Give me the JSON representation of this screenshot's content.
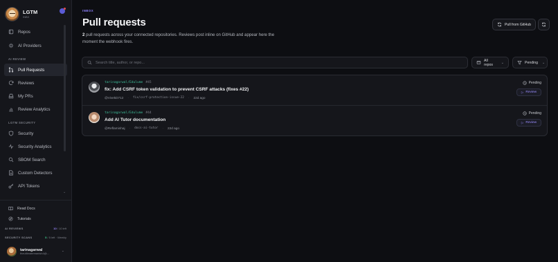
{
  "brand": {
    "name": "LGTM",
    "sub": "INBX"
  },
  "nav": {
    "top": [
      {
        "label": "Repos",
        "icon": "repo-icon",
        "active": false
      },
      {
        "label": "AI Providers",
        "icon": "sparkle-icon",
        "active": false
      }
    ],
    "ai_review_label": "AI REVIEW",
    "ai_review": [
      {
        "label": "Pull Requests",
        "icon": "pull-request-icon",
        "active": true
      },
      {
        "label": "Reviews",
        "icon": "refresh-icon",
        "active": false
      },
      {
        "label": "My PRs",
        "icon": "inbox-icon",
        "active": false
      },
      {
        "label": "Review Analytics",
        "icon": "chart-icon",
        "active": false
      }
    ],
    "security_label": "LGTM SECURITY",
    "security": [
      {
        "label": "Security",
        "icon": "shield-icon",
        "active": false
      },
      {
        "label": "Security Analytics",
        "icon": "activity-icon",
        "active": false
      },
      {
        "label": "SBOM Search",
        "icon": "search-icon",
        "active": false
      },
      {
        "label": "Custom Detectors",
        "icon": "file-icon",
        "active": false
      },
      {
        "label": "API Tokens",
        "icon": "key-icon",
        "active": false
      }
    ]
  },
  "bottom": {
    "read_docs": "Read Docs",
    "tutorials": "Tutorials",
    "ai_reviews_label": "AI REVIEWS",
    "ai_reviews_used": "10",
    "ai_reviews_rest": "/ 10 left",
    "security_scans_label": "SECURITY SCANS",
    "security_scans_used": "5",
    "security_scans_rest": "/ 5 left · Weekly",
    "user_name": "tarinagarwal",
    "user_email": "theultimatemanish4@..."
  },
  "header": {
    "eyebrow": "INBOX",
    "title": "Pull requests",
    "desc_count": "2",
    "desc_text": " pull requests across your connected repositories. Reviews post inline on GitHub and appear here the moment the webhook fires.",
    "pull_button": "Pull from GitHub"
  },
  "filters": {
    "search_placeholder": "Search title, author, or repo...",
    "repos": "All repos",
    "status": "Pending"
  },
  "prs": [
    {
      "repo": "tarinagarwal/Edulume",
      "number": "#45",
      "title": "fix: Add CSRF token validation to prevent CSRF attacks (fixes #22)",
      "author": "@VivekD712",
      "branch": "fix/csrf-protection-issue-22",
      "age": "22d ago",
      "status": "Pending",
      "action": "Review"
    },
    {
      "repo": "tarinagarwal/Edulume",
      "number": "#44",
      "title": "Add AI Tutor documentation",
      "author": "@Reflaminhaj",
      "branch": "docs-ai-tutor",
      "age": "22d ago",
      "status": "Pending",
      "action": "Review"
    }
  ]
}
